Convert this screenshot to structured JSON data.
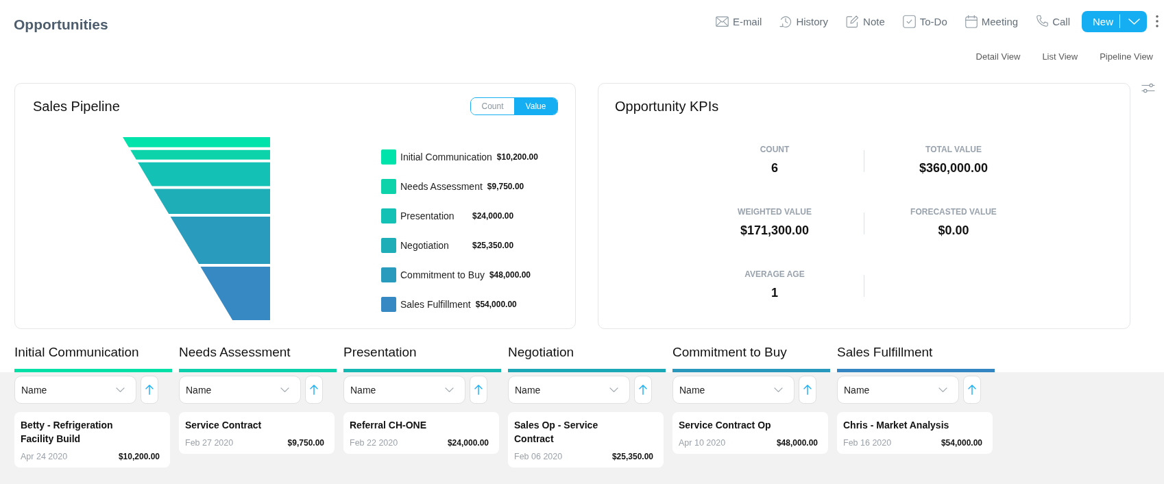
{
  "header": {
    "title": "Opportunities"
  },
  "toolbar": {
    "actions": [
      {
        "label": "E-mail"
      },
      {
        "label": "History"
      },
      {
        "label": "Note"
      },
      {
        "label": "To-Do"
      },
      {
        "label": "Meeting"
      },
      {
        "label": "Call"
      }
    ],
    "new_button": {
      "label": "New"
    }
  },
  "views": [
    {
      "label": "Detail View"
    },
    {
      "label": "List View"
    },
    {
      "label": "Pipeline View"
    }
  ],
  "sales_pipeline": {
    "title": "Sales Pipeline",
    "toggle": [
      {
        "label": "Count",
        "selected": false
      },
      {
        "label": "Value",
        "selected": true
      }
    ],
    "stages": [
      {
        "name": "Initial Communication",
        "value": "$10,200.00",
        "color": "#00e3aa"
      },
      {
        "name": "Needs Assessment",
        "value": "$9,750.00",
        "color": "#0dd3ab"
      },
      {
        "name": "Presentation",
        "value": "$24,000.00",
        "color": "#13c1b5"
      },
      {
        "name": "Negotiation",
        "value": "$25,350.00",
        "color": "#1eaeb8"
      },
      {
        "name": "Commitment to Buy",
        "value": "$48,000.00",
        "color": "#299cbd"
      },
      {
        "name": "Sales Fulfillment",
        "value": "$54,000.00",
        "color": "#3689c3"
      }
    ]
  },
  "kpis": {
    "title": "Opportunity KPIs",
    "metrics": [
      {
        "label": "COUNT",
        "value": "6"
      },
      {
        "label": "TOTAL VALUE",
        "value": "$360,000.00"
      },
      {
        "label": "WEIGHTED VALUE",
        "value": "$171,300.00"
      },
      {
        "label": "FORECASTED VALUE",
        "value": "$0.00"
      },
      {
        "label": "AVERAGE AGE",
        "value": "1"
      }
    ]
  },
  "board": {
    "columns": [
      {
        "title": "Initial Communication",
        "color": "#00e0a7",
        "sort_field": "Name",
        "cards": [
          {
            "title": "Betty - Refrigeration Facility Build",
            "date": "Apr 24 2020",
            "amount": "$10,200.00"
          }
        ]
      },
      {
        "title": "Needs Assessment",
        "color": "#0ccfab",
        "sort_field": "Name",
        "cards": [
          {
            "title": "Service Contract",
            "date": "Feb 27 2020",
            "amount": "$9,750.00"
          }
        ]
      },
      {
        "title": "Presentation",
        "color": "#13b8b2",
        "sort_field": "Name",
        "cards": [
          {
            "title": "Referral CH-ONE",
            "date": "Feb 22 2020",
            "amount": "$24,000.00"
          }
        ]
      },
      {
        "title": "Negotiation",
        "color": "#1aa8b6",
        "sort_field": "Name",
        "cards": [
          {
            "title": "Sales Op - Service Contract",
            "date": "Feb 06 2020",
            "amount": "$25,350.00"
          }
        ]
      },
      {
        "title": "Commitment to Buy",
        "color": "#2899bc",
        "sort_field": "Name",
        "cards": [
          {
            "title": "Service Contract Op",
            "date": "Apr 10 2020",
            "amount": "$48,000.00"
          }
        ]
      },
      {
        "title": "Sales Fulfillment",
        "color": "#3486c2",
        "sort_field": "Name",
        "cards": [
          {
            "title": "Chris - Market Analysis",
            "date": "Feb 16 2020",
            "amount": "$54,000.00"
          }
        ]
      }
    ]
  }
}
